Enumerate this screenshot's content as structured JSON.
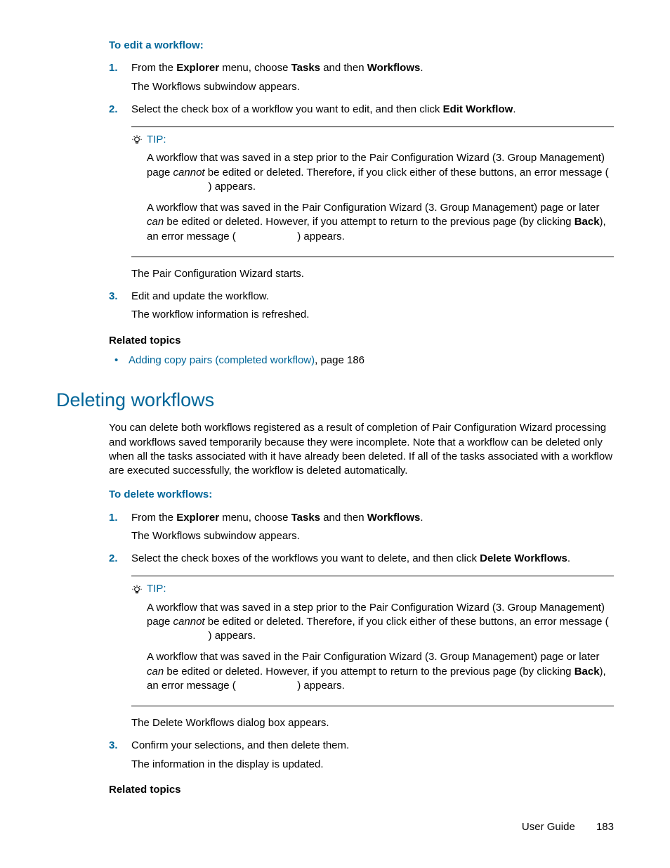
{
  "edit": {
    "heading": "To edit a workflow:",
    "step1_a": "From the ",
    "step1_b": "Explorer",
    "step1_c": " menu, choose ",
    "step1_d": "Tasks",
    "step1_e": " and then ",
    "step1_f": "Workflows",
    "step1_g": ".",
    "step1_sub": "The Workflows subwindow appears.",
    "step2_a": "Select the check box of a workflow you want to edit, and then click ",
    "step2_b": "Edit Workflow",
    "step2_c": ".",
    "step2_sub": "The Pair Configuration Wizard starts.",
    "step3": "Edit and update the workflow.",
    "step3_sub": "The workflow information is refreshed."
  },
  "tip": {
    "label": "TIP:",
    "p1_a": "A workflow that was saved in a step prior to the Pair Configuration Wizard (3. Group Management) page ",
    "p1_b": "cannot",
    "p1_c": " be edited or deleted. Therefore, if you click either of these buttons, an error message (",
    "p1_d": ") appears.",
    "p2_a": "A workflow that was saved in the Pair Configuration Wizard (3. Group Management) page or later ",
    "p2_b": "can",
    "p2_c": " be edited or deleted. However, if you attempt to return to the previous page (by clicking ",
    "p2_d": "Back",
    "p2_e": "), an error message (",
    "p2_f": ") appears."
  },
  "related_label": "Related topics",
  "related1_link": "Adding copy pairs (completed workflow)",
  "related1_tail": ", page 186",
  "delete": {
    "title": "Deleting workflows",
    "intro": "You can delete both workflows registered as a result of completion of Pair Configuration Wizard processing and workflows saved temporarily because they were incomplete. Note that a workflow can be deleted only when all the tasks associated with it have already been deleted. If all of the tasks associated with a workflow are executed successfully, the workflow is deleted automatically.",
    "heading": "To delete workflows:",
    "step1_a": "From the ",
    "step1_b": "Explorer",
    "step1_c": " menu, choose ",
    "step1_d": "Tasks",
    "step1_e": " and then ",
    "step1_f": "Workflows",
    "step1_g": ".",
    "step1_sub": "The Workflows subwindow appears.",
    "step2_a": "Select the check boxes of the workflows you want to delete, and then click ",
    "step2_b": "Delete Workflows",
    "step2_c": ".",
    "step2_sub": "The Delete Workflows dialog box appears.",
    "step3": "Confirm your selections, and then delete them.",
    "step3_sub": "The information in the display is updated."
  },
  "nums": {
    "n1": "1.",
    "n2": "2.",
    "n3": "3."
  },
  "footer": {
    "label": "User Guide",
    "page": "183"
  },
  "gap": "                     "
}
